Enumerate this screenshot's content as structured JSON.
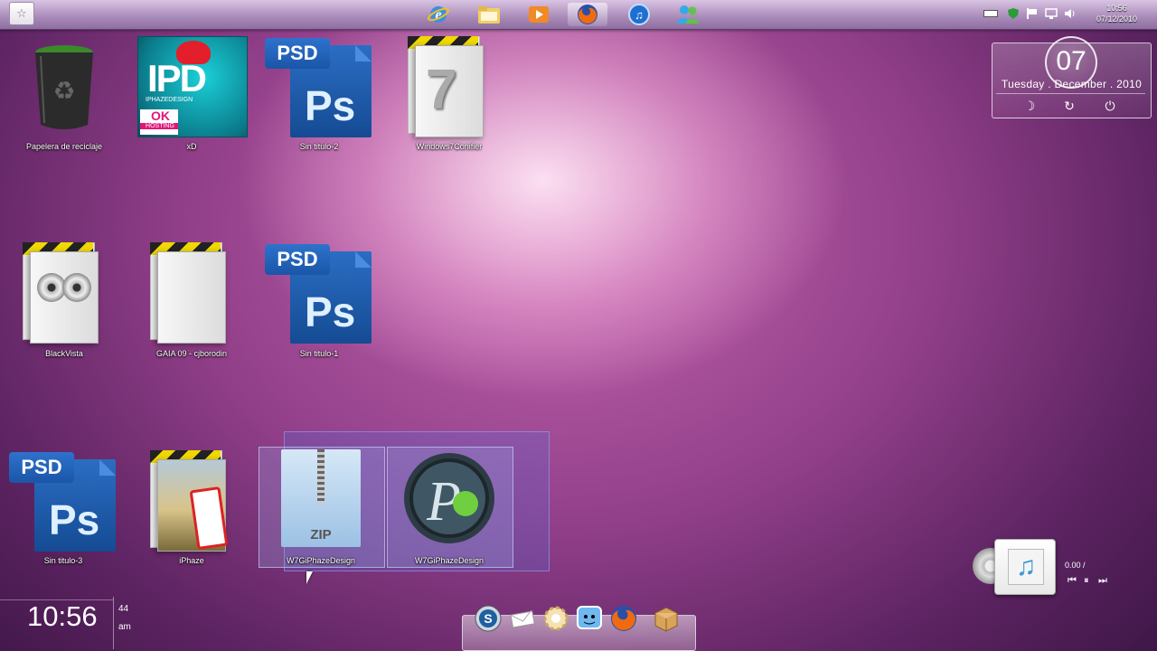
{
  "taskbar": {
    "pinned": [
      {
        "name": "internet-explorer-icon"
      },
      {
        "name": "explorer-folder-icon"
      },
      {
        "name": "media-player-icon"
      },
      {
        "name": "firefox-icon"
      },
      {
        "name": "itunes-icon"
      },
      {
        "name": "messenger-icon"
      }
    ],
    "clock_time": "10:56",
    "clock_date": "07/12/2010"
  },
  "desktop": {
    "icons": [
      {
        "label": "Papelera de reciclaje"
      },
      {
        "label": "xD"
      },
      {
        "label": "Sin titulo-2"
      },
      {
        "label": "Windows7Conifier"
      },
      {
        "label": "BlackVista"
      },
      {
        "label": "GAIA 09 - cjborodin"
      },
      {
        "label": "Sin titulo-1"
      },
      {
        "label": "Sin titulo-3"
      },
      {
        "label": "iPhaze"
      },
      {
        "label": "W7GiPhazeDesign"
      },
      {
        "label": "W7GiPhazeDesign"
      }
    ],
    "xd_badge_top": "IPD",
    "xd_badge_sub": "IPHAZEDESIGN",
    "xd_badge_ok": "OK",
    "xd_badge_hosting": "HOSTING",
    "psd_tag": "PSD",
    "ps_text": "Ps",
    "zip_text": "ZIP"
  },
  "datetime_gadget": {
    "day_number": "07",
    "date_line": "Tuesday . December . 2010"
  },
  "clock_gadget": {
    "time": "10:56",
    "seconds": "44",
    "ampm": "am"
  },
  "music_gadget": {
    "time": "0.00 /"
  }
}
